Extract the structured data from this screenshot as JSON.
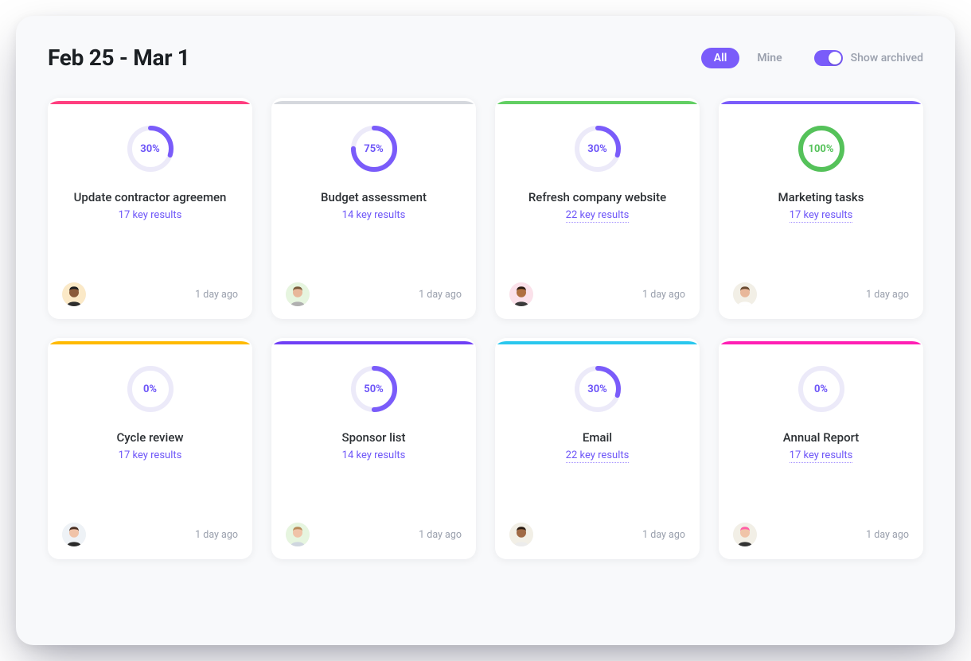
{
  "title": "Feb 25 - Mar 1",
  "filter": {
    "options": [
      "All",
      "Mine"
    ],
    "active_index": 0
  },
  "archive_toggle": {
    "label": "Show archived",
    "on": true
  },
  "colors": {
    "accent_purple": "#7a5cfa",
    "ring_track": "#eceaf9",
    "ring_progress": "#7a5cfa",
    "ring_done": "#55c25a"
  },
  "cards": [
    {
      "title": "Update contractor agreemen",
      "results_label": "17 key results",
      "results_link_style": "plain",
      "percent": 30,
      "percent_label": "30%",
      "accent": "#ff3e7f",
      "time": "1 day ago",
      "avatar_bg": "#fbe9c7",
      "avatar_skin": "#8a5a3a",
      "avatar_hair": "#1c1c1c",
      "avatar_shirt": "#2d2d2d"
    },
    {
      "title": "Budget assessment",
      "results_label": "14 key results",
      "results_link_style": "plain",
      "percent": 75,
      "percent_label": "75%",
      "accent": "#d5d8dd",
      "time": "1 day ago",
      "avatar_bg": "#e6f5df",
      "avatar_skin": "#e8b79a",
      "avatar_hair": "#7a5a3a",
      "avatar_shirt": "#b0b0b0"
    },
    {
      "title": "Refresh company website",
      "results_label": "22 key results",
      "results_link_style": "link",
      "percent": 30,
      "percent_label": "30%",
      "accent": "#62cf63",
      "time": "1 day ago",
      "avatar_bg": "#fbe1ea",
      "avatar_skin": "#b07040",
      "avatar_hair": "#2a1a10",
      "avatar_shirt": "#3a3a3a"
    },
    {
      "title": "Marketing tasks",
      "results_label": "17 key results",
      "results_link_style": "link",
      "percent": 100,
      "percent_label": "100%",
      "accent": "#7a5cfa",
      "done": true,
      "time": "1 day ago",
      "avatar_bg": "#f2efe6",
      "avatar_skin": "#e8b79a",
      "avatar_hair": "#6a4a30",
      "avatar_shirt": "#ffffff"
    },
    {
      "title": "Cycle review",
      "results_label": "17 key results",
      "results_link_style": "plain",
      "percent": 0,
      "percent_label": "0%",
      "accent": "#ffba00",
      "time": "1 day ago",
      "avatar_bg": "#eef2f6",
      "avatar_skin": "#f0c3a8",
      "avatar_hair": "#4a2f22",
      "avatar_shirt": "#2b2b2b"
    },
    {
      "title": "Sponsor list",
      "results_label": "14 key results",
      "results_link_style": "plain",
      "percent": 50,
      "percent_label": "50%",
      "accent": "#6f3ff5",
      "time": "1 day ago",
      "avatar_bg": "#e6f5df",
      "avatar_skin": "#f0c3a8",
      "avatar_hair": "#b88a5a",
      "avatar_shirt": "#cfd6df"
    },
    {
      "title": "Email",
      "results_label": "22 key results",
      "results_link_style": "link",
      "percent": 30,
      "percent_label": "30%",
      "accent": "#29c7ee",
      "time": "1 day ago",
      "avatar_bg": "#f2efe6",
      "avatar_skin": "#a06a45",
      "avatar_hair": "#2a1a10",
      "avatar_shirt": "#ececec"
    },
    {
      "title": "Annual Report",
      "results_label": "17 key results",
      "results_link_style": "link",
      "percent": 0,
      "percent_label": "0%",
      "accent": "#ff1fb4",
      "time": "1 day ago",
      "avatar_bg": "#f2efe6",
      "avatar_skin": "#f0c3a8",
      "avatar_hair": "#ff5fa6",
      "avatar_shirt": "#333333"
    }
  ]
}
